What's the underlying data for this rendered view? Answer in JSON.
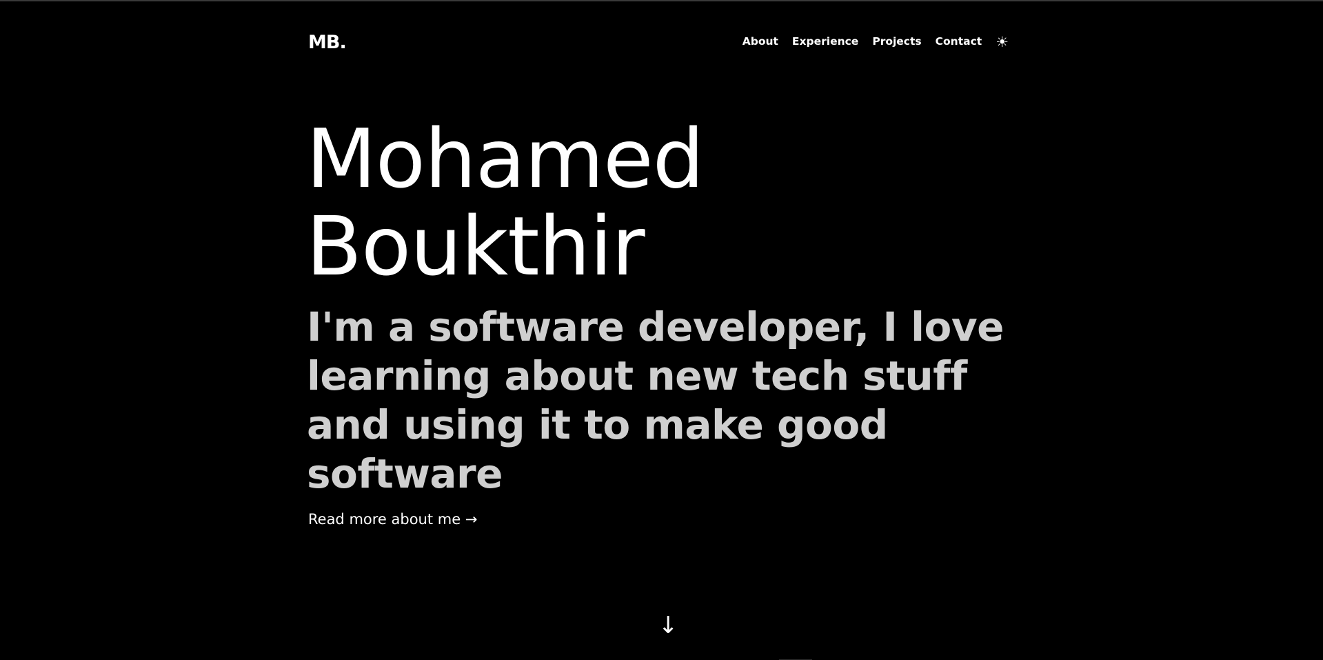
{
  "header": {
    "logo": "MB.",
    "nav": [
      {
        "label": "About"
      },
      {
        "label": "Experience"
      },
      {
        "label": "Projects"
      },
      {
        "label": "Contact"
      }
    ],
    "theme_toggle_icon": "☀",
    "theme_toggle_name": "sun-icon"
  },
  "hero": {
    "name_line1": "Mohamed",
    "name_line2": "Boukthir",
    "tagline": "I'm a software developer, I love learning about new tech stuff and using it to make good software",
    "read_more": "Read more about me →"
  },
  "scroll": {
    "arrow": "↓",
    "icon_name": "arrow-down-icon"
  },
  "colors": {
    "background": "#000000",
    "text": "#ffffff",
    "tagline": "#cfcfcf"
  }
}
